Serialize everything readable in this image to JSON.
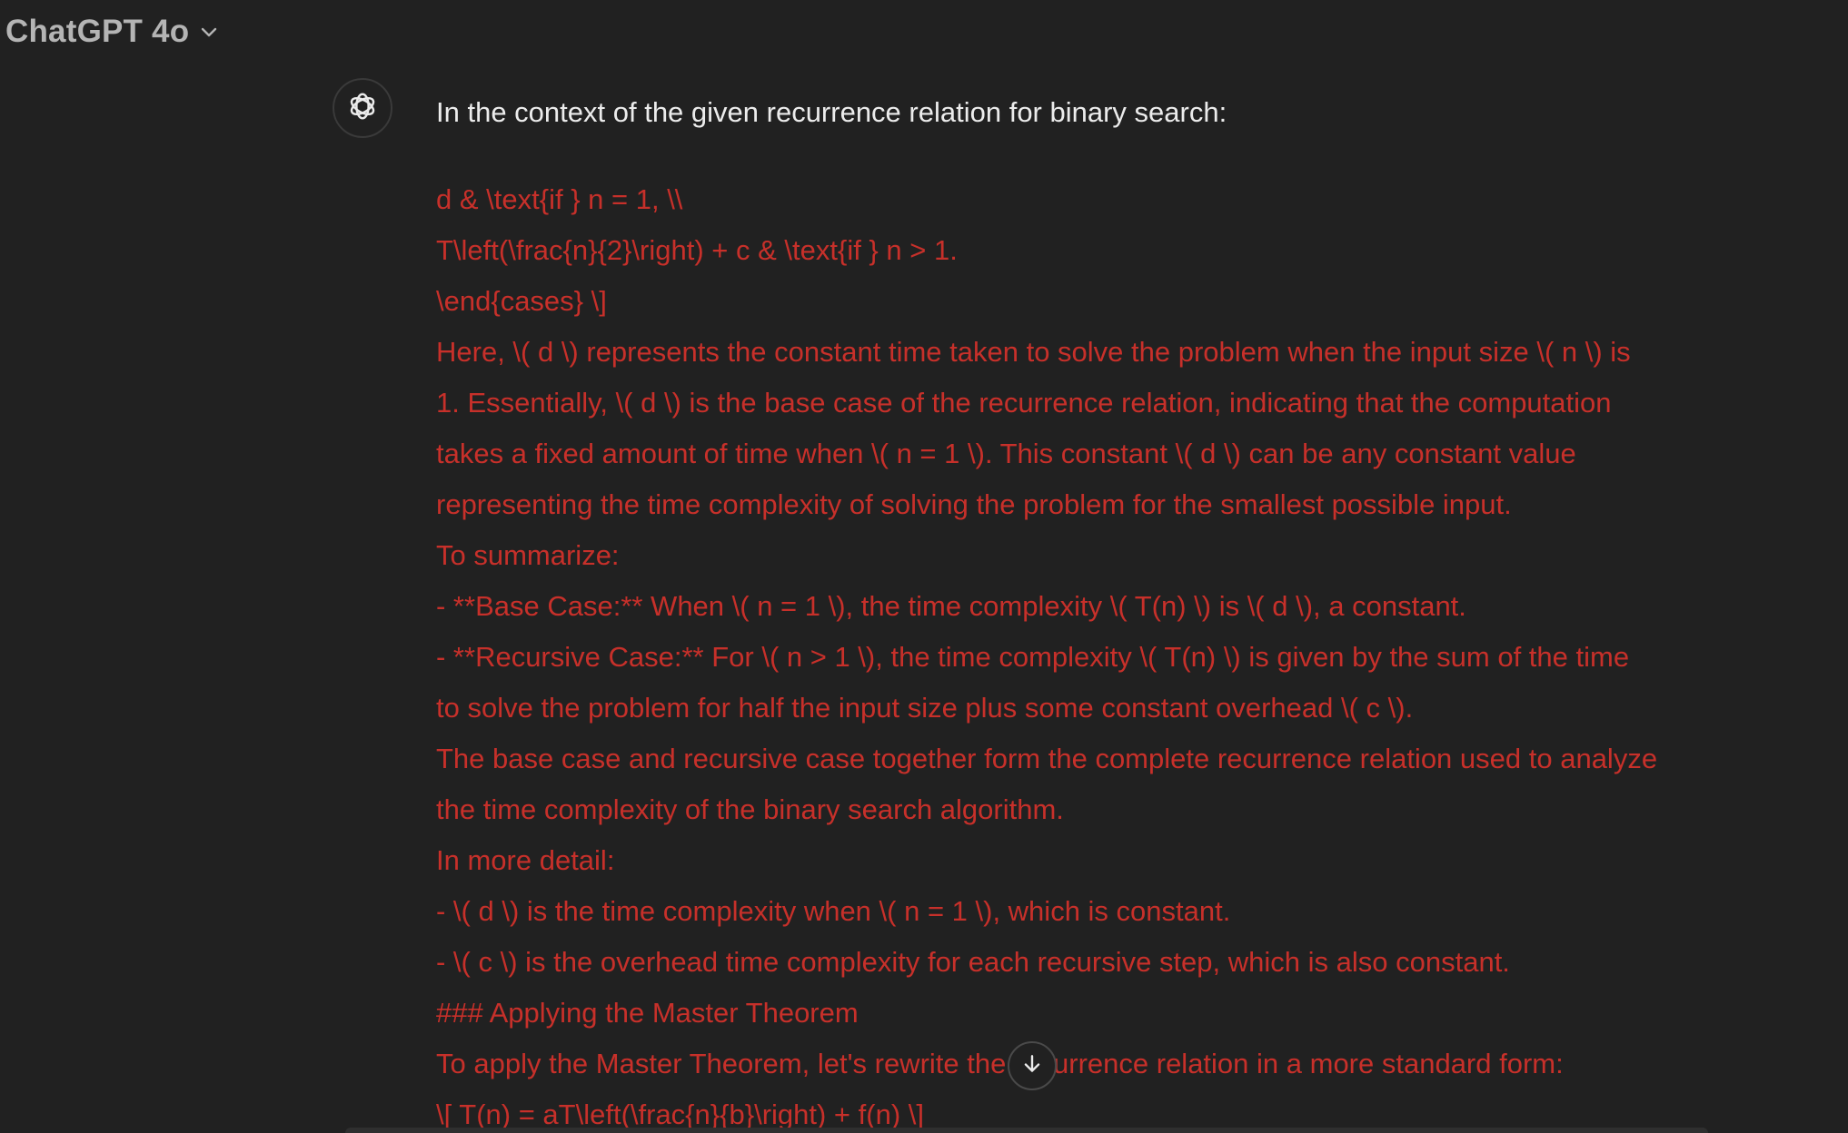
{
  "header": {
    "model_label": "ChatGPT 4o",
    "dropdown_icon": "chevron-down-icon"
  },
  "avatar": {
    "icon": "openai-logo-icon"
  },
  "message": {
    "intro": "In the context of the given recurrence relation for binary search:",
    "lines": [
      "d & \\text{if } n = 1, \\\\",
      "T\\left(\\frac{n}{2}\\right) + c & \\text{if } n > 1.",
      "\\end{cases} \\]",
      "Here, \\( d \\) represents the constant time taken to solve the problem when the input size \\( n \\) is",
      "1. Essentially, \\( d \\) is the base case of the recurrence relation, indicating that the computation",
      "takes a fixed amount of time when \\( n = 1 \\). This constant \\( d \\) can be any constant value",
      "representing the time complexity of solving the problem for the smallest possible input.",
      "To summarize:",
      "- **Base Case:** When \\( n = 1 \\), the time complexity \\( T(n) \\) is \\( d \\), a constant.",
      "- **Recursive Case:** For \\( n > 1 \\), the time complexity \\( T(n) \\) is given by the sum of the time",
      "to solve the problem for half the input size plus some constant overhead \\( c \\).",
      "The base case and recursive case together form the complete recurrence relation used to analyze",
      "the time complexity of the binary search algorithm.",
      "In more detail:",
      "- \\( d \\) is the time complexity when \\( n = 1 \\), which is constant.",
      "- \\( c \\) is the overhead time complexity for each recursive step, which is also constant.",
      "### Applying the Master Theorem",
      "To apply the Master Theorem, let's rewrite the recurrence relation in a more standard form:",
      "\\[ T(n) = aT\\left(\\frac{n}{b}\\right) + f(n) \\]"
    ]
  },
  "scroll_button": {
    "icon": "arrow-down-icon"
  },
  "colors": {
    "background": "#212121",
    "error_text": "#c7302a",
    "primary_text": "#ececec",
    "header_text": "#b4b4b4"
  }
}
